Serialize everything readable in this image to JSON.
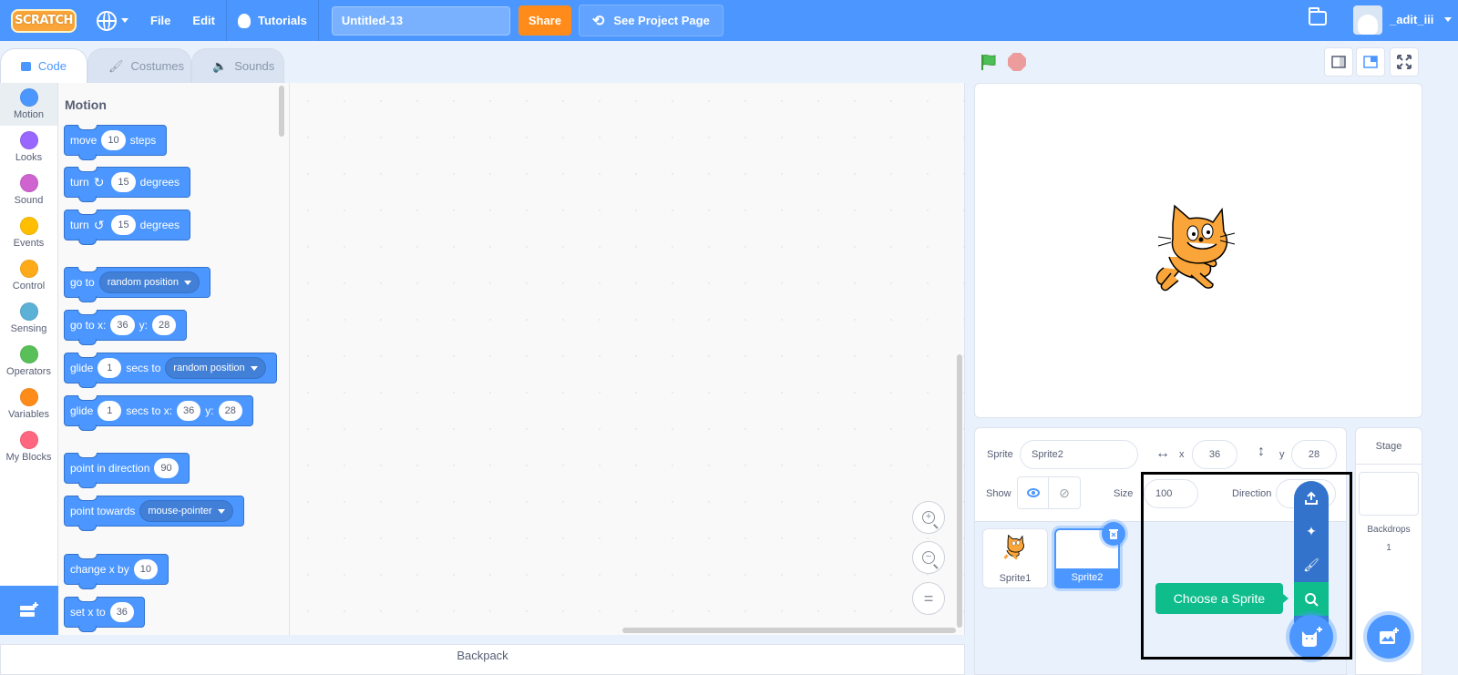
{
  "menubar": {
    "logo": "SCRATCH",
    "file": "File",
    "edit": "Edit",
    "tutorials": "Tutorials",
    "project_title": "Untitled-13",
    "share": "Share",
    "see_project_page": "See Project Page",
    "username": "_adit_iii",
    "accent": "#4c97ff"
  },
  "tabs": [
    {
      "label": "Code",
      "icon": "code-icon",
      "active": true
    },
    {
      "label": "Costumes",
      "icon": "brush-icon",
      "active": false
    },
    {
      "label": "Sounds",
      "icon": "speaker-icon",
      "active": false
    }
  ],
  "categories": [
    {
      "label": "Motion",
      "color": "#4c97ff"
    },
    {
      "label": "Looks",
      "color": "#9966ff"
    },
    {
      "label": "Sound",
      "color": "#cf63cf"
    },
    {
      "label": "Events",
      "color": "#ffbf00"
    },
    {
      "label": "Control",
      "color": "#ffab19"
    },
    {
      "label": "Sensing",
      "color": "#5cb1d6"
    },
    {
      "label": "Operators",
      "color": "#59c059"
    },
    {
      "label": "Variables",
      "color": "#ff8c1a"
    },
    {
      "label": "My Blocks",
      "color": "#ff6680"
    }
  ],
  "palette": {
    "title": "Motion",
    "blocks": {
      "move": {
        "t1": "move",
        "v1": "10",
        "t2": "steps"
      },
      "turn_right": {
        "t1": "turn",
        "v1": "15",
        "t2": "degrees"
      },
      "turn_left": {
        "t1": "turn",
        "v1": "15",
        "t2": "degrees"
      },
      "goto": {
        "t1": "go to",
        "d1": "random position"
      },
      "goto_xy": {
        "t1": "go to x:",
        "v1": "36",
        "t2": "y:",
        "v2": "28"
      },
      "glide_to": {
        "t1": "glide",
        "v1": "1",
        "t2": "secs to",
        "d1": "random position"
      },
      "glide_xy": {
        "t1": "glide",
        "v1": "1",
        "t2": "secs to x:",
        "v2": "36",
        "t3": "y:",
        "v3": "28"
      },
      "point_dir": {
        "t1": "point in direction",
        "v1": "90"
      },
      "point_towards": {
        "t1": "point towards",
        "d1": "mouse-pointer"
      },
      "change_x": {
        "t1": "change x by",
        "v1": "10"
      },
      "set_x": {
        "t1": "set x to",
        "v1": "36"
      }
    }
  },
  "backpack": "Backpack",
  "sprite_info": {
    "sprite_label": "Sprite",
    "sprite_name": "Sprite2",
    "x_label": "x",
    "x": "36",
    "y_label": "y",
    "y": "28",
    "show_label": "Show",
    "size_label": "Size",
    "size": "100",
    "direction_label": "Direction",
    "direction": ""
  },
  "sprites": [
    {
      "name": "Sprite1",
      "selected": false
    },
    {
      "name": "Sprite2",
      "selected": true
    }
  ],
  "sprite_menu": {
    "tooltip": "Choose a Sprite",
    "items": [
      "upload-icon",
      "surprise-icon",
      "paint-icon",
      "search-icon"
    ]
  },
  "stage_pane": {
    "title": "Stage",
    "backdrops_label": "Backdrops",
    "backdrops_count": "1"
  }
}
